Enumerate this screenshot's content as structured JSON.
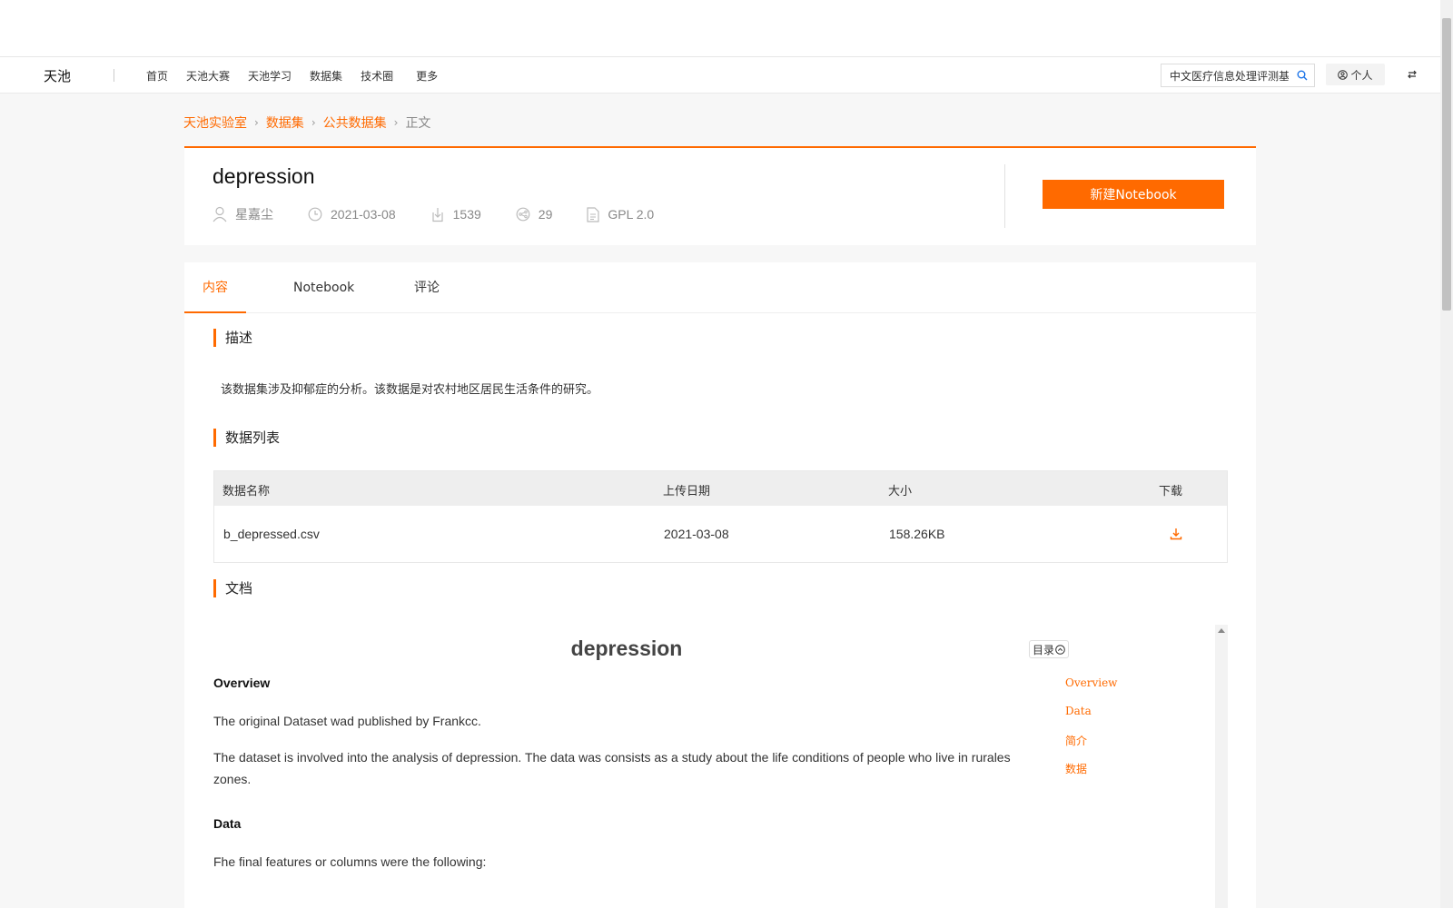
{
  "nav": {
    "logo": "天池",
    "links": [
      "首页",
      "天池大赛",
      "天池学习",
      "数据集",
      "技术圈",
      "更多"
    ],
    "search_value": "中文医疗信息处理评测基",
    "user_label": "个人"
  },
  "breadcrumb": [
    "天池实验室",
    "数据集",
    "公共数据集",
    "正文"
  ],
  "dataset": {
    "title": "depression",
    "author": "星嘉尘",
    "date": "2021-03-08",
    "downloads": "1539",
    "shares": "29",
    "license": "GPL 2.0",
    "new_notebook_label": "新建Notebook"
  },
  "tabs": [
    "内容",
    "Notebook",
    "评论"
  ],
  "sections": {
    "description_title": "描述",
    "description_text": "该数据集涉及抑郁症的分析。该数据是对农村地区居民生活条件的研究。",
    "datalist_title": "数据列表",
    "doc_title": "文档"
  },
  "table": {
    "headers": [
      "数据名称",
      "上传日期",
      "大小",
      "下载"
    ],
    "rows": [
      {
        "name": "b_depressed.csv",
        "date": "2021-03-08",
        "size": "158.26KB"
      }
    ]
  },
  "doc": {
    "h1": "depression",
    "overview_heading": "Overview",
    "p1": "The original Dataset wad published by Frankcc.",
    "p2": "The dataset is involved into the analysis of depression. The data was consists as a study about the life conditions of people who live in rurales zones.",
    "data_heading": "Data",
    "p3": "Fhe final features or columns were the following:",
    "toc_label": "目录",
    "toc_items": [
      "Overview",
      "Data",
      "简介",
      "数据"
    ]
  },
  "colors": {
    "accent": "#ff6a00"
  }
}
